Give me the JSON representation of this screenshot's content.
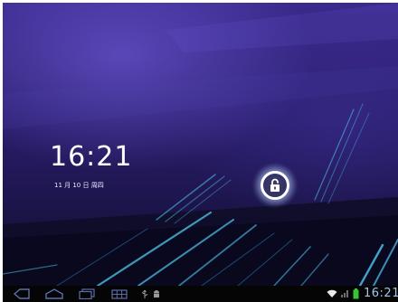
{
  "lockscreen": {
    "time": "16:21",
    "date": "11 月 10 日 周四"
  },
  "icons": {
    "unlock": "lock-open-icon",
    "back": "back-icon",
    "home": "home-icon",
    "recent_apps": "recent-apps-icon",
    "screenshot": "screenshot-icon",
    "usb": "usb-icon",
    "notification": "android-notification-icon",
    "wifi": "wifi-icon",
    "signal": "signal-icon",
    "battery": "battery-icon"
  },
  "status_bar": {
    "time": "16:21"
  },
  "colors": {
    "nav_icon": "#5a6fb0",
    "status_accent": "#33b5e5",
    "battery": "#38c438"
  }
}
